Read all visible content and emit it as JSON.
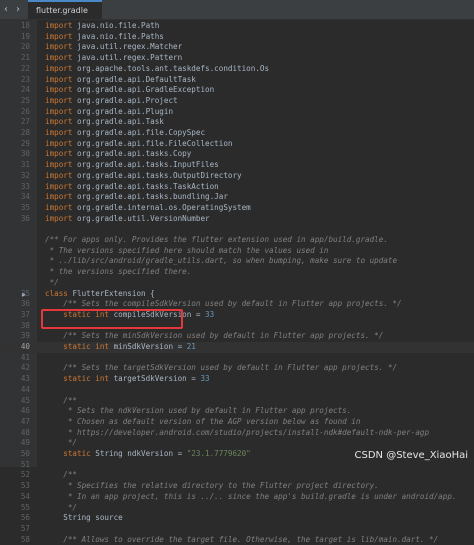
{
  "tab": {
    "title": "flutter.gradle"
  },
  "watermark": "CSDN @Steve_XiaoHai",
  "highlight": {
    "line_number": 40,
    "color": "#e5383b"
  },
  "lines": [
    {
      "n": "18",
      "segs": [
        [
          "kw",
          "import "
        ],
        [
          "",
          "java.nio.file.Path"
        ]
      ]
    },
    {
      "n": "19",
      "segs": [
        [
          "kw",
          "import "
        ],
        [
          "",
          "java.nio.file.Paths"
        ]
      ]
    },
    {
      "n": "20",
      "segs": [
        [
          "kw",
          "import "
        ],
        [
          "",
          "java.util.regex.Matcher"
        ]
      ]
    },
    {
      "n": "21",
      "segs": [
        [
          "kw",
          "import "
        ],
        [
          "",
          "java.util.regex.Pattern"
        ]
      ]
    },
    {
      "n": "22",
      "segs": [
        [
          "kw",
          "import "
        ],
        [
          "",
          "org.apache.tools.ant.taskdefs.condition.Os"
        ]
      ]
    },
    {
      "n": "23",
      "segs": [
        [
          "kw",
          "import "
        ],
        [
          "",
          "org.gradle.api.DefaultTask"
        ]
      ]
    },
    {
      "n": "24",
      "segs": [
        [
          "kw",
          "import "
        ],
        [
          "",
          "org.gradle.api.GradleException"
        ]
      ]
    },
    {
      "n": "25",
      "segs": [
        [
          "kw",
          "import "
        ],
        [
          "",
          "org.gradle.api.Project"
        ]
      ]
    },
    {
      "n": "26",
      "segs": [
        [
          "kw",
          "import "
        ],
        [
          "",
          "org.gradle.api.Plugin"
        ]
      ]
    },
    {
      "n": "27",
      "segs": [
        [
          "kw",
          "import "
        ],
        [
          "",
          "org.gradle.api.Task"
        ]
      ]
    },
    {
      "n": "28",
      "segs": [
        [
          "kw",
          "import "
        ],
        [
          "",
          "org.gradle.api.file.CopySpec"
        ]
      ]
    },
    {
      "n": "29",
      "segs": [
        [
          "kw",
          "import "
        ],
        [
          "",
          "org.gradle.api.file.FileCollection"
        ]
      ]
    },
    {
      "n": "30",
      "segs": [
        [
          "kw",
          "import "
        ],
        [
          "",
          "org.gradle.api.tasks.Copy"
        ]
      ]
    },
    {
      "n": "31",
      "segs": [
        [
          "kw",
          "import "
        ],
        [
          "",
          "org.gradle.api.tasks.InputFiles"
        ]
      ]
    },
    {
      "n": "32",
      "segs": [
        [
          "kw",
          "import "
        ],
        [
          "",
          "org.gradle.api.tasks.OutputDirectory"
        ]
      ]
    },
    {
      "n": "33",
      "segs": [
        [
          "kw",
          "import "
        ],
        [
          "",
          "org.gradle.api.tasks.TaskAction"
        ]
      ]
    },
    {
      "n": "34",
      "segs": [
        [
          "kw",
          "import "
        ],
        [
          "",
          "org.gradle.api.tasks.bundling.Jar"
        ]
      ]
    },
    {
      "n": "35",
      "segs": [
        [
          "kw",
          "import "
        ],
        [
          "",
          "org.gradle.internal.os.OperatingSystem"
        ]
      ]
    },
    {
      "n": "36",
      "segs": [
        [
          "kw",
          "import "
        ],
        [
          "",
          "org.gradle.util.VersionNumber"
        ]
      ]
    },
    {
      "n": "",
      "segs": []
    },
    {
      "n": "",
      "segs": [
        [
          "gc",
          "/** For apps only. Provides the flutter extension used in app/build.gradle."
        ]
      ]
    },
    {
      "n": "",
      "segs": [
        [
          "gc",
          " * The versions specified here should match the values used in"
        ]
      ]
    },
    {
      "n": "",
      "segs": [
        [
          "gc",
          " * ../lib/src/android/gradle_utils.dart, so when bumping, make sure to update"
        ]
      ]
    },
    {
      "n": "",
      "segs": [
        [
          "gc",
          " * the versions specified there."
        ]
      ]
    },
    {
      "n": "",
      "segs": [
        [
          "gc",
          " */"
        ]
      ]
    },
    {
      "n": "35",
      "icon": true,
      "segs": [
        [
          "kw",
          "class "
        ],
        [
          "",
          "FlutterExtension {"
        ]
      ]
    },
    {
      "n": "36",
      "segs": [
        [
          "gc",
          "    /** Sets the compileSdkVersion used by default in Flutter app projects. */"
        ]
      ]
    },
    {
      "n": "37",
      "segs": [
        [
          "kw",
          "    static int "
        ],
        [
          "",
          "compileSdkVersion = "
        ],
        [
          "num",
          "33"
        ]
      ]
    },
    {
      "n": "38",
      "segs": []
    },
    {
      "n": "39",
      "segs": [
        [
          "gc",
          "    /** Sets the minSdkVersion used by default in Flutter app projects. */"
        ]
      ]
    },
    {
      "n": "40",
      "cur": true,
      "segs": [
        [
          "kw",
          "    static int "
        ],
        [
          "",
          "minSdkVersion = "
        ],
        [
          "num",
          "21"
        ]
      ]
    },
    {
      "n": "41",
      "segs": []
    },
    {
      "n": "42",
      "segs": [
        [
          "gc",
          "    /** Sets the targetSdkVersion used by default in Flutter app projects. */"
        ]
      ]
    },
    {
      "n": "43",
      "segs": [
        [
          "kw",
          "    static int "
        ],
        [
          "",
          "targetSdkVersion = "
        ],
        [
          "num",
          "33"
        ]
      ]
    },
    {
      "n": "44",
      "segs": []
    },
    {
      "n": "45",
      "segs": [
        [
          "gc",
          "    /**"
        ]
      ]
    },
    {
      "n": "46",
      "segs": [
        [
          "gc",
          "     * Sets the ndkVersion used by default in Flutter app projects."
        ]
      ]
    },
    {
      "n": "47",
      "segs": [
        [
          "gc",
          "     * Chosen as default version of the AGP version below as found in"
        ]
      ]
    },
    {
      "n": "48",
      "segs": [
        [
          "gc",
          "     * https://developer.android.com/studio/projects/install-ndk#default-ndk-per-agp"
        ]
      ]
    },
    {
      "n": "49",
      "segs": [
        [
          "gc",
          "     */"
        ]
      ]
    },
    {
      "n": "50",
      "segs": [
        [
          "kw",
          "    static "
        ],
        [
          "",
          "String ndkVersion = "
        ],
        [
          "str",
          "\"23.1.7779620\""
        ]
      ]
    },
    {
      "n": "51",
      "segs": []
    },
    {
      "n": "52",
      "segs": [
        [
          "gc",
          "    /**"
        ]
      ]
    },
    {
      "n": "53",
      "segs": [
        [
          "gc",
          "     * Specifies the relative directory to the Flutter project directory."
        ]
      ]
    },
    {
      "n": "54",
      "segs": [
        [
          "gc",
          "     * In an app project, this is ../.. since the app's build.gradle is under android/app."
        ]
      ]
    },
    {
      "n": "55",
      "segs": [
        [
          "gc",
          "     */"
        ]
      ]
    },
    {
      "n": "56",
      "segs": [
        [
          "",
          "    String source"
        ]
      ]
    },
    {
      "n": "57",
      "segs": []
    },
    {
      "n": "58",
      "segs": [
        [
          "gc",
          "    /** Allows to override the target file. Otherwise, the target is lib/main.dart. */"
        ]
      ]
    }
  ]
}
